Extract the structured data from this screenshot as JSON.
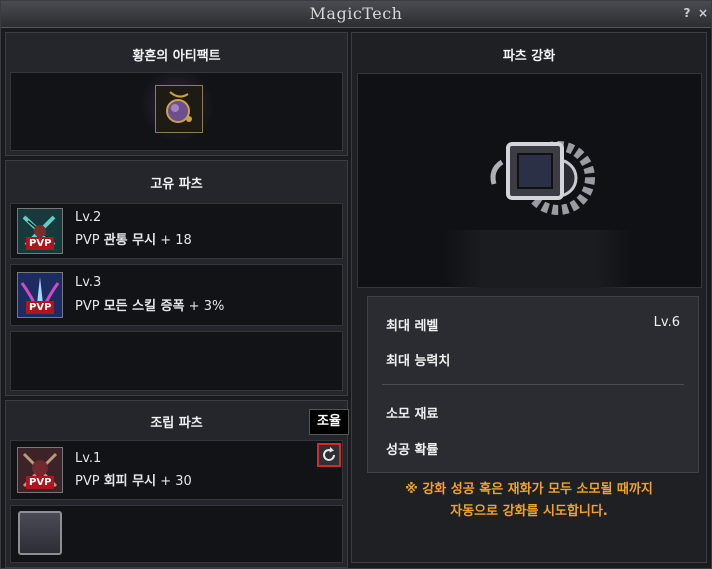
{
  "window": {
    "title": "MagicTech",
    "help_label": "?",
    "close_label": "×"
  },
  "artifact": {
    "title": "황혼의 아티팩트",
    "icon": "pendant-orb-icon"
  },
  "unique_parts": {
    "title": "고유 파츠",
    "items": [
      {
        "level": "Lv.2",
        "prefix": "PVP",
        "name": "관통 무시",
        "value": "+ 18",
        "icon": "pvp-crossed-blades-icon",
        "badge": "PVP"
      },
      {
        "level": "Lv.3",
        "prefix": "PVP",
        "name": "모든 스킬 증폭",
        "value": "+  3%",
        "icon": "pvp-blue-wings-icon",
        "badge": "PVP"
      }
    ]
  },
  "assembly_parts": {
    "title": "조립 파츠",
    "tooltip": "조율",
    "items": [
      {
        "level": "Lv.1",
        "prefix": "PVP",
        "name": "회피 무시",
        "value": "+ 30",
        "icon": "pvp-crossed-swords-icon",
        "badge": "PVP"
      }
    ],
    "refresh_icon": "refresh-icon",
    "empty_slot_icon": "empty-slot-icon"
  },
  "enhance": {
    "title": "파츠 강화",
    "gear_icon": "gear-frame-icon",
    "stats": {
      "max_level_label": "최대 레벨",
      "max_level_value": "Lv.6",
      "max_stat_label": "최대 능력치",
      "material_label": "소모 재료",
      "success_label": "성공 확률"
    },
    "notice_line1": "※ 강화 성공 혹은 재화가 모두 소모될 때까지",
    "notice_line2": "자동으로 강화를 시도합니다."
  },
  "colors": {
    "notice": "#f0a229",
    "highlight_border": "#d42a2a"
  }
}
